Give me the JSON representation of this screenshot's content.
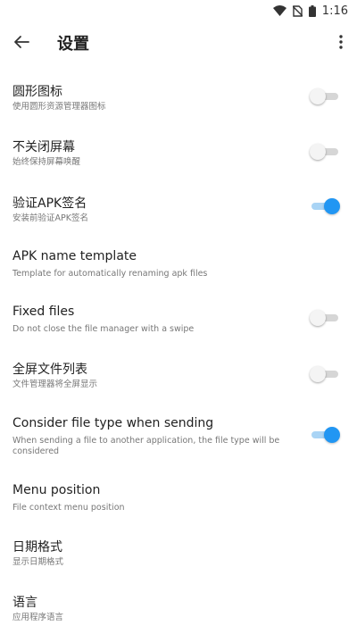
{
  "status_bar": {
    "time": "1:16"
  },
  "app_bar": {
    "title": "设置"
  },
  "settings": [
    {
      "title": "圆形图标",
      "summary": "使用圆形资源管理器图标",
      "toggle": "off"
    },
    {
      "title": "不关闭屏幕",
      "summary": "始终保持屏幕唤醒",
      "toggle": "off"
    },
    {
      "title": "验证APK签名",
      "summary": "安装前验证APK签名",
      "toggle": "on"
    },
    {
      "title": "APK name template",
      "summary": "Template for automatically renaming apk files",
      "toggle": null
    },
    {
      "title": "Fixed files",
      "summary": "Do not close the file manager with a swipe",
      "toggle": "off"
    },
    {
      "title": "全屏文件列表",
      "summary": "文件管理器将全屏显示",
      "toggle": "off"
    },
    {
      "title": "Consider file type when sending",
      "summary": "When sending a file to another application, the file type will be considered",
      "toggle": "on"
    },
    {
      "title": "Menu position",
      "summary": "File context menu position",
      "toggle": null
    },
    {
      "title": "日期格式",
      "summary": "显示日期格式",
      "toggle": null
    },
    {
      "title": "语言",
      "summary": "应用程序语言",
      "toggle": null
    }
  ],
  "colors": {
    "accent": "#2196f3",
    "accent_track": "#a9d4f5",
    "switch_off_track": "#d6d6d6"
  }
}
